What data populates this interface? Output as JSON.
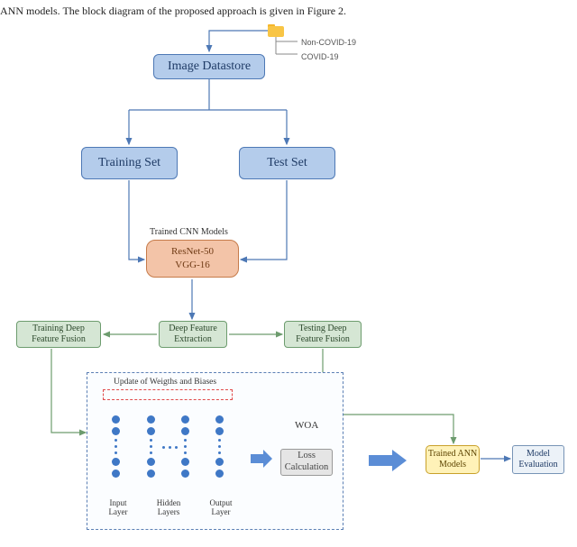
{
  "caption": "ANN models. The block diagram of the proposed approach is given in Figure 2.",
  "folder": {
    "class1": "Non-COVID-19",
    "class2": "COVID-19"
  },
  "boxes": {
    "image_datastore": "Image Datastore",
    "training_set": "Training Set",
    "test_set": "Test Set",
    "cnn_title": "Trained CNN Models",
    "cnn_line1": "ResNet-50",
    "cnn_line2": "VGG-16",
    "training_fusion_l1": "Training Deep",
    "training_fusion_l2": "Feature Fusion",
    "deep_feat_l1": "Deep Feature",
    "deep_feat_l2": "Extraction",
    "testing_fusion_l1": "Testing Deep",
    "testing_fusion_l2": "Feature Fusion",
    "trained_ann_l1": "Trained ANN",
    "trained_ann_l2": "Models",
    "model_eval_l1": "Model",
    "model_eval_l2": "Evaluation"
  },
  "nn": {
    "update_label": "Update of Weigths and Biases",
    "input_l1": "Input",
    "input_l2": "Layer",
    "hidden_l1": "Hidden",
    "hidden_l2": "Layers",
    "output_l1": "Output",
    "output_l2": "Layer",
    "woa": "WOA",
    "loss_l1": "Loss",
    "loss_l2": "Calculation"
  }
}
